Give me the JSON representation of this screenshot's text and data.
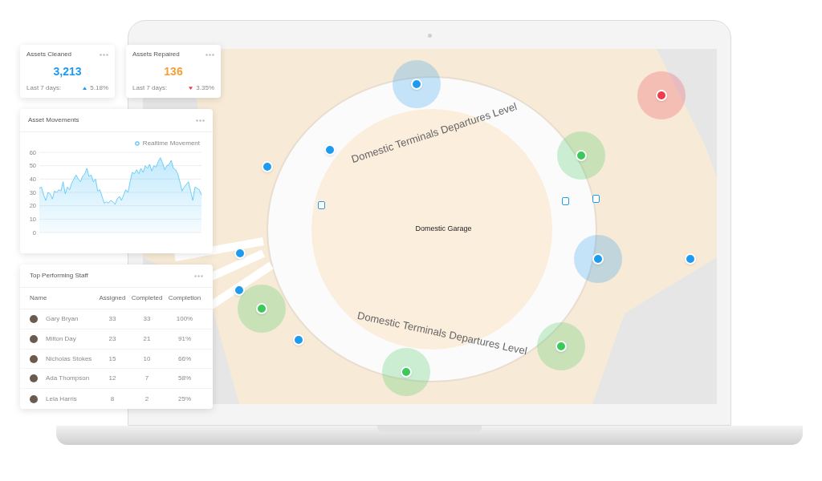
{
  "stat_cards": [
    {
      "title": "Assets Cleaned",
      "value": "3,213",
      "period": "Last 7 days:",
      "trend_up": true,
      "change": "5.18%"
    },
    {
      "title": "Assets Repaired",
      "value": "136",
      "period": "Last 7 days:",
      "trend_up": false,
      "change": "3.35%"
    }
  ],
  "movement_card": {
    "title": "Asset Movements",
    "chart_data": {
      "type": "area",
      "grid": true,
      "ylim": [
        0,
        60
      ],
      "yticks": [
        0,
        10,
        20,
        30,
        40,
        50,
        60
      ],
      "series": [
        {
          "name": "Realtime Movement",
          "color": "#4fc3f7",
          "values": [
            33,
            34,
            28,
            24,
            30,
            29,
            25,
            31,
            30,
            32,
            31,
            38,
            29,
            34,
            32,
            37,
            40,
            43,
            40,
            38,
            42,
            44,
            48,
            42,
            43,
            38,
            40,
            31,
            32,
            27,
            22,
            23,
            22,
            24,
            23,
            21,
            25,
            27,
            24,
            28,
            32,
            30,
            38,
            45,
            44,
            47,
            44,
            48,
            45,
            50,
            48,
            51,
            46,
            50,
            49,
            53,
            56,
            52,
            47,
            50,
            51,
            54,
            48,
            47,
            44,
            38,
            31,
            34,
            36,
            38,
            31,
            24,
            34,
            33,
            32,
            28
          ]
        }
      ]
    }
  },
  "staff_card": {
    "title": "Top Performing Staff",
    "columns": [
      "Name",
      "Assigned",
      "Completed",
      "Completion"
    ],
    "rows": [
      {
        "name": "Gary Bryan",
        "assigned": "33",
        "completed": "33",
        "completion": "100%"
      },
      {
        "name": "Milton Day",
        "assigned": "23",
        "completed": "21",
        "completion": "91%"
      },
      {
        "name": "Nicholas Stokes",
        "assigned": "15",
        "completed": "10",
        "completion": "66%"
      },
      {
        "name": "Ada Thompson",
        "assigned": "12",
        "completed": "7",
        "completion": "58%"
      },
      {
        "name": "Lela Harris",
        "assigned": "8",
        "completed": "2",
        "completion": "25%"
      }
    ]
  },
  "map": {
    "labels": [
      "Domestic Terminals Departures Level",
      "Domestic Garage",
      "Domestic Terminals Departures Level"
    ],
    "pins": [
      {
        "color": "#1e9bf0",
        "halo": true
      },
      {
        "color": "#ef3b4e",
        "halo": true
      },
      {
        "color": "#1e9bf0",
        "halo": false
      },
      {
        "color": "#3cc85a",
        "halo": true
      },
      {
        "color": "#1e9bf0",
        "halo": false
      },
      {
        "color": "#1e9bf0",
        "halo": true
      },
      {
        "color": "#1e9bf0",
        "halo": false
      },
      {
        "color": "#1e9bf0",
        "halo": false
      },
      {
        "color": "#1e9bf0",
        "halo": false
      },
      {
        "color": "#3cc85a",
        "halo": true
      },
      {
        "color": "#1e9bf0",
        "halo": false
      },
      {
        "color": "#3cc85a",
        "halo": true
      },
      {
        "color": "#3cc85a",
        "halo": true
      }
    ]
  }
}
